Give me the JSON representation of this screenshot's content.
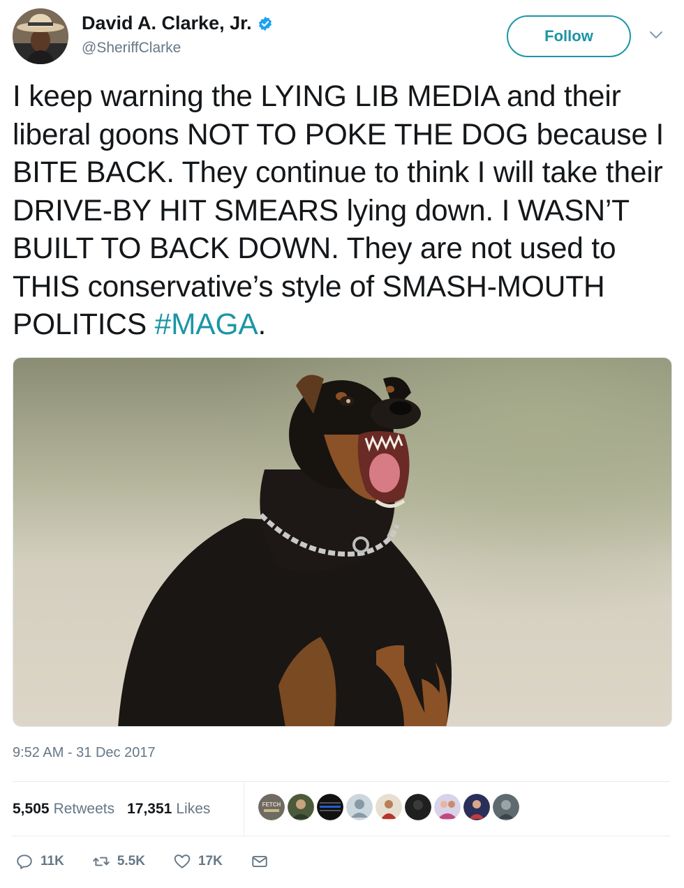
{
  "author": {
    "display_name": "David A. Clarke, Jr.",
    "handle": "@SheriffClarke",
    "verified": true,
    "avatar_icon": "profile-photo-cowboy-hat"
  },
  "follow_button": {
    "label": "Follow"
  },
  "menu_icon": "chevron-down-icon",
  "tweet": {
    "text_main": "I keep warning the LYING LIB MEDIA and their liberal goons NOT TO POKE THE DOG because I BITE BACK. They continue to think I will take their DRIVE-BY HIT SMEARS lying down. I WASN’T BUILT TO BACK DOWN. They are not used to THIS conservative’s style of SMASH-MOUTH POLITICS ",
    "hashtag": "#MAGA",
    "text_end": ".",
    "media_description_icon": "photo-snarling-rottweiler"
  },
  "timestamp": "9:52 AM - 31 Dec 2017",
  "stats": {
    "retweets_count": "5,505",
    "retweets_label": "Retweets",
    "likes_count": "17,351",
    "likes_label": "Likes"
  },
  "liker_avatars": [
    {
      "icon": "fetch-avatar",
      "label": "FETCH"
    },
    {
      "icon": "user-avatar"
    },
    {
      "icon": "flag-avatar"
    },
    {
      "icon": "default-avatar"
    },
    {
      "icon": "user-avatar"
    },
    {
      "icon": "user-avatar"
    },
    {
      "icon": "user-avatar"
    },
    {
      "icon": "user-avatar"
    },
    {
      "icon": "user-avatar"
    }
  ],
  "actions": {
    "replies": "11K",
    "retweets": "5.5K",
    "likes": "17K"
  },
  "colors": {
    "accent": "#1b95a6",
    "verified": "#1da1f2",
    "muted": "#657786"
  }
}
